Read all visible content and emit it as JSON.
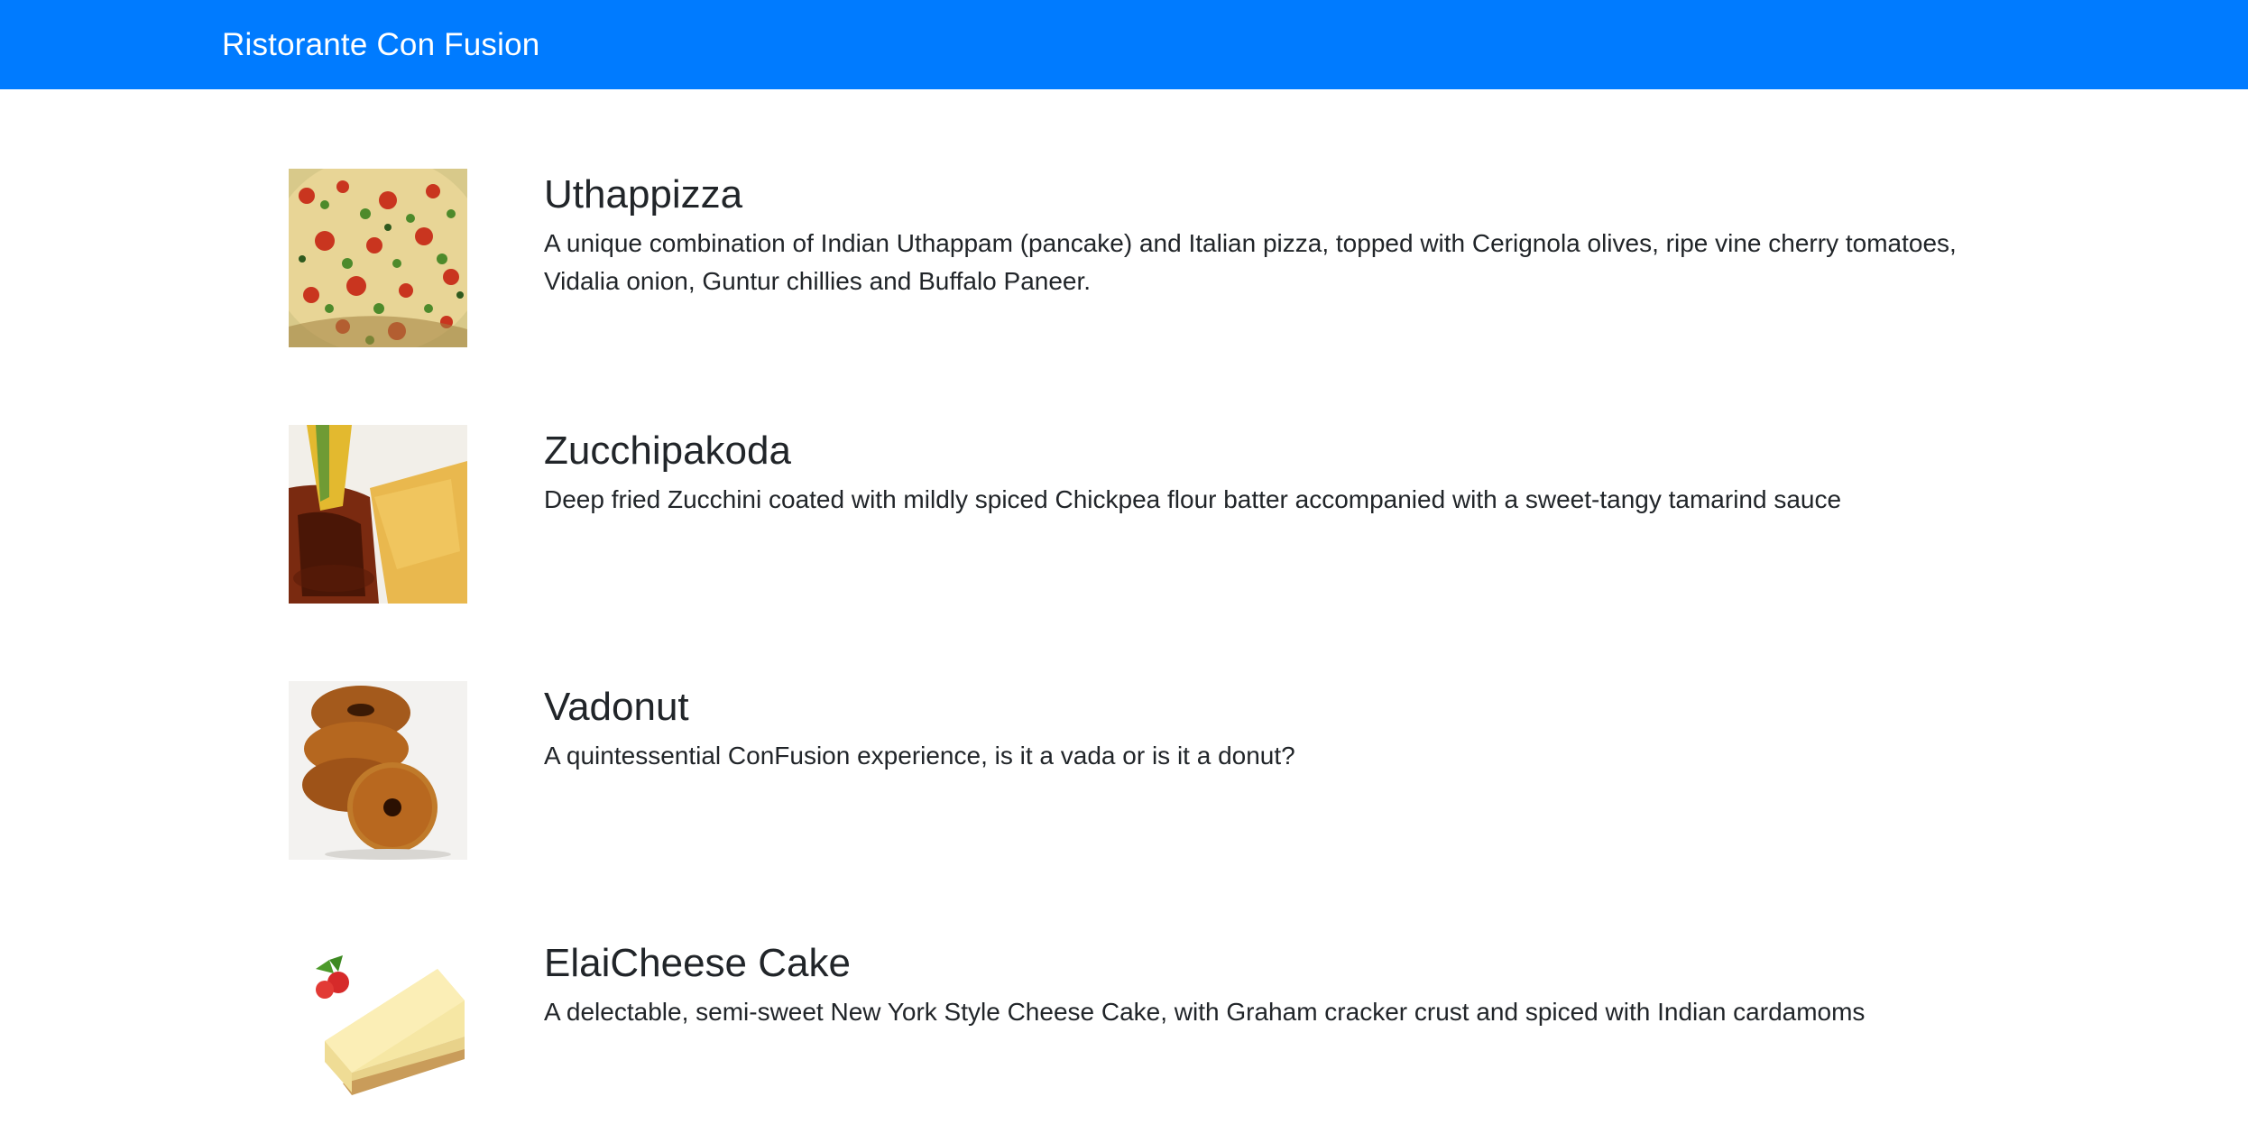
{
  "navbar": {
    "brand": "Ristorante Con Fusion",
    "color": "#007bff"
  },
  "menu": {
    "dishes": [
      {
        "image_icon": "pizza-image",
        "name": "Uthappizza",
        "description": "A unique combination of Indian Uthappam (pancake) and Italian pizza, topped with Cerignola olives, ripe vine cherry tomatoes, Vidalia onion, Guntur chillies and Buffalo Paneer."
      },
      {
        "image_icon": "zucchini-pakoda-image",
        "name": "Zucchipakoda",
        "description": "Deep fried Zucchini coated with mildly spiced Chickpea flour batter accompanied with a sweet-tangy tamarind sauce"
      },
      {
        "image_icon": "vadonut-image",
        "name": "Vadonut",
        "description": "A quintessential ConFusion experience, is it a vada or is it a donut?"
      },
      {
        "image_icon": "cheesecake-image",
        "name": "ElaiCheese Cake",
        "description": "A delectable, semi-sweet New York Style Cheese Cake, with Graham cracker crust and spiced with Indian cardamoms"
      }
    ]
  }
}
